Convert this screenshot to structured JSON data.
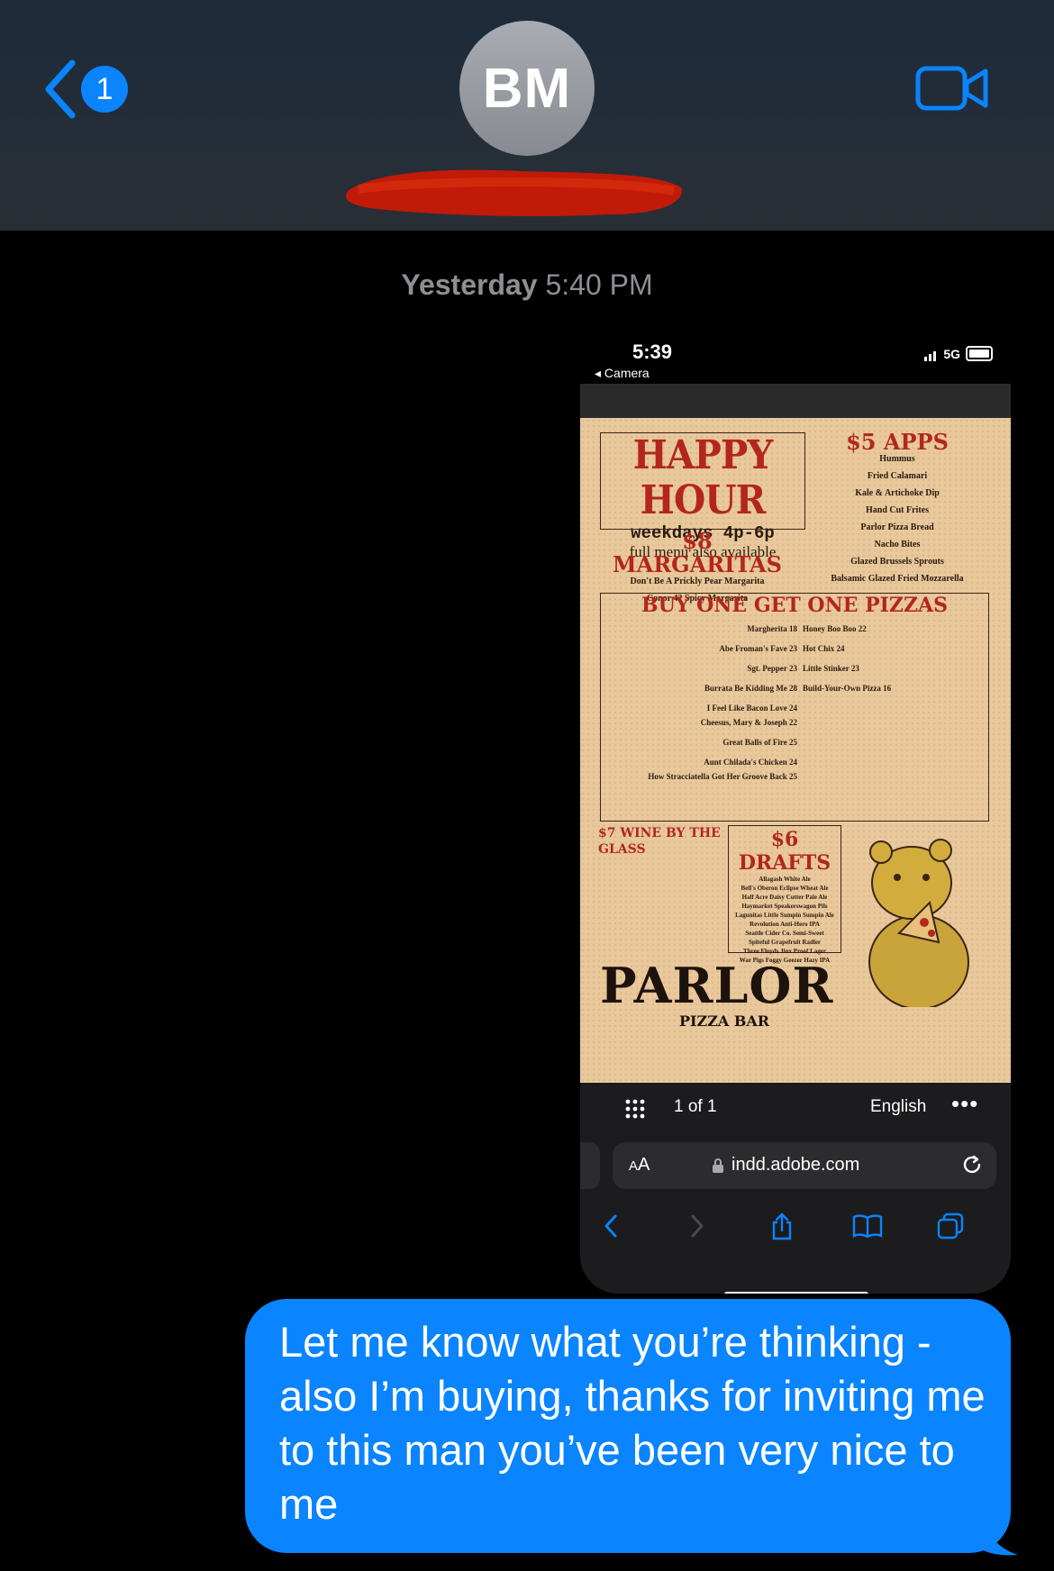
{
  "header": {
    "back_badge": "1",
    "contact_initials": "BM"
  },
  "thread": {
    "timestamp_day": "Yesterday",
    "timestamp_time": "5:40 PM"
  },
  "screenshot": {
    "status_time": "5:39",
    "back_to_app": "◂ Camera",
    "network": "5G",
    "viewer_page": "1 of 1",
    "viewer_language": "English",
    "url": "indd.adobe.com",
    "menu": {
      "happy_hour": "HAPPY HOUR",
      "hours": "weekdays 4p-6p",
      "full_menu": "full menu also available",
      "apps_title": "$5 APPS",
      "apps": [
        "Hummus",
        "Fried Calamari",
        "Kale & Artichoke Dip",
        "Hand Cut Frites",
        "Parlor Pizza Bread",
        "Nacho Bites",
        "Glazed Brussels Sprouts",
        "Balsamic Glazed Fried Mozzarella"
      ],
      "margaritas_title": "$8 MARGARITAS",
      "margaritas": [
        "Don't Be A Prickly Pear Margarita",
        "Conor 42 Spicy Margarita"
      ],
      "bogo_title": "BUY ONE GET ONE PIZZAS",
      "pizzas_left": [
        "Margherita 18",
        "Abe Froman's Fave 23",
        "Sgt. Pepper 23",
        "Burrata Be Kidding Me 28",
        "I Feel Like Bacon Love 24",
        "Cheesus, Mary & Joseph 22",
        "Great Balls of Fire 25",
        "Aunt Chilada's Chicken 24",
        "How Stracciatella Got Her Groove Back 25"
      ],
      "pizzas_right": [
        "Honey Boo Boo 22",
        "Hot Chix 24",
        "Little Stinker 23",
        "Build-Your-Own Pizza 16"
      ],
      "wine_title": "$7 WINE BY THE GLASS",
      "drafts_title": "$6 DRAFTS",
      "drafts": [
        "Allagash White Ale",
        "Bell's Oberon Eclipse Wheat Ale",
        "Half Acre Daisy Cutter Pale Ale",
        "Haymarket Speakerswagon Pils",
        "Lagunitas Little Sumpin Sumpin Ale",
        "Revolution Anti-Hero IPA",
        "Seattle Cider Co. Semi-Sweet",
        "Spiteful Grapefruit Radler",
        "Three Floyds Jinx Proof Lager",
        "War Pigs Foggy Geezer Hazy IPA"
      ],
      "logo": "PARLOR",
      "logo_sub": "PIZZA BAR"
    }
  },
  "message": {
    "text": "Let me know what you’re thinking - also I’m buying, thanks for inviting me to this man you’ve been very nice to me"
  },
  "colors": {
    "accent": "#0a84ff",
    "bubble": "#0a84ff",
    "menu_paper": "#e9c99c",
    "menu_red": "#b3261e",
    "redaction": "#c21a08"
  }
}
